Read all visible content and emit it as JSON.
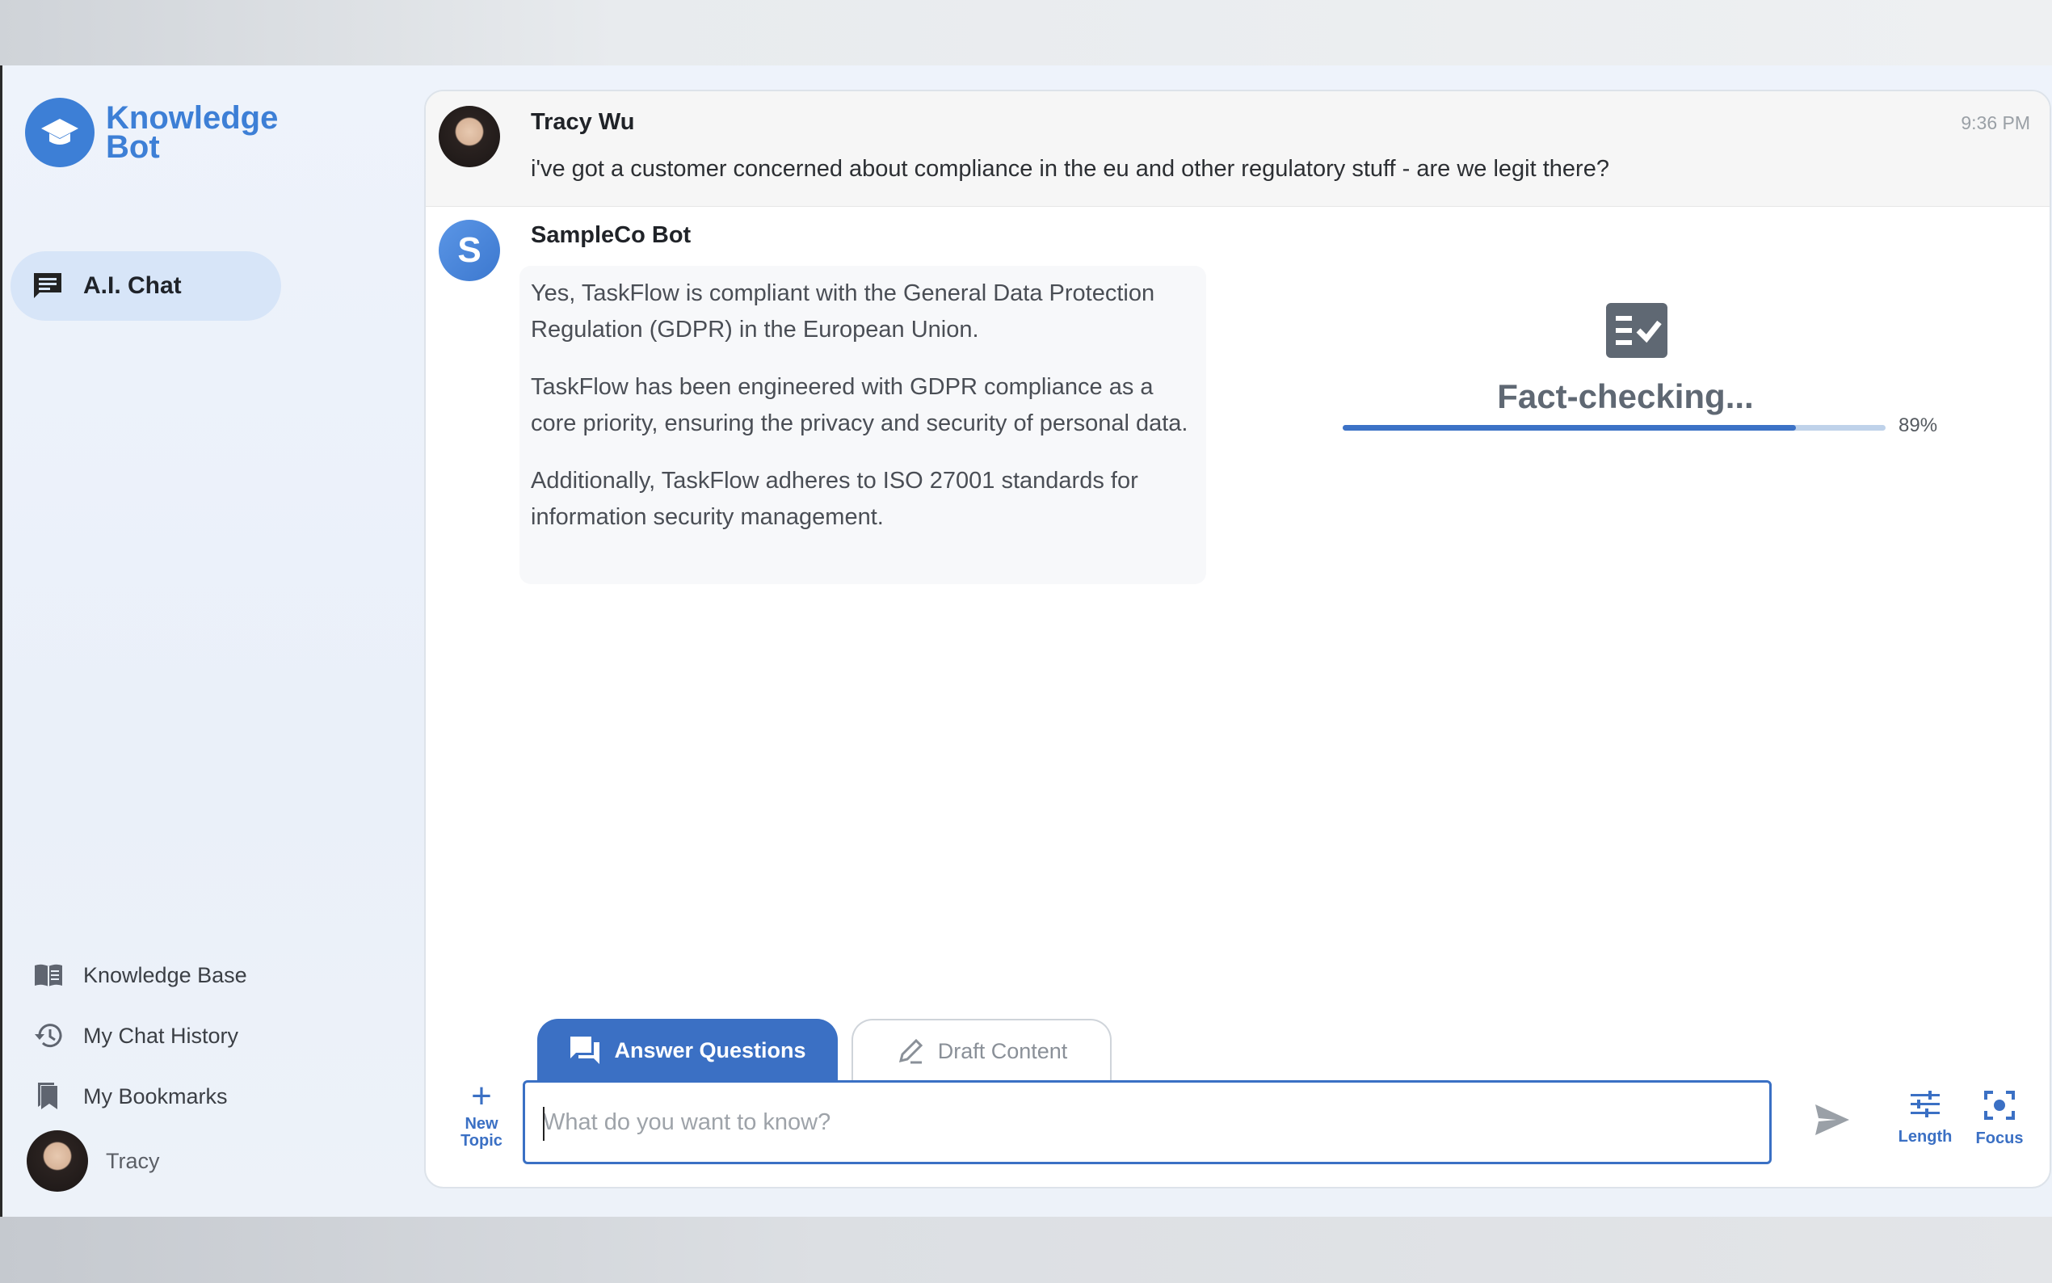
{
  "app": {
    "logo_line1": "Knowledge",
    "logo_line2": "Bot"
  },
  "sidebar": {
    "active_item": "A.I. Chat",
    "items": [
      {
        "label": "Knowledge Base",
        "icon": "book-icon"
      },
      {
        "label": "My Chat History",
        "icon": "history-icon"
      },
      {
        "label": "My Bookmarks",
        "icon": "bookmark-icon"
      }
    ],
    "user_name": "Tracy"
  },
  "chat": {
    "user_message": {
      "sender": "Tracy Wu",
      "time": "9:36 PM",
      "text": "i've got a customer concerned about compliance in the eu and other regulatory stuff - are we legit there?"
    },
    "bot_message": {
      "avatar_letter": "S",
      "sender": "SampleCo Bot",
      "paragraphs": [
        "Yes, TaskFlow is compliant with the General Data Protection Regulation (GDPR) in the European Union.",
        "TaskFlow has been engineered with GDPR compliance as a core priority, ensuring the privacy and security of personal data.",
        "Additionally, TaskFlow adheres to ISO 27001 standards for information security management."
      ]
    },
    "fact_check": {
      "title": "Fact-checking...",
      "progress": 0.835,
      "percent_label": "89%"
    }
  },
  "composer": {
    "tabs": [
      {
        "label": "Answer Questions",
        "active": true
      },
      {
        "label": "Draft Content",
        "active": false
      }
    ],
    "new_topic_line1": "New",
    "new_topic_line2": "Topic",
    "placeholder": "What do you want to know?",
    "length_label": "Length",
    "focus_label": "Focus"
  },
  "colors": {
    "accent": "#3b70c4",
    "logo": "#3d7fd6",
    "active_nav": "#d7e5f8"
  }
}
